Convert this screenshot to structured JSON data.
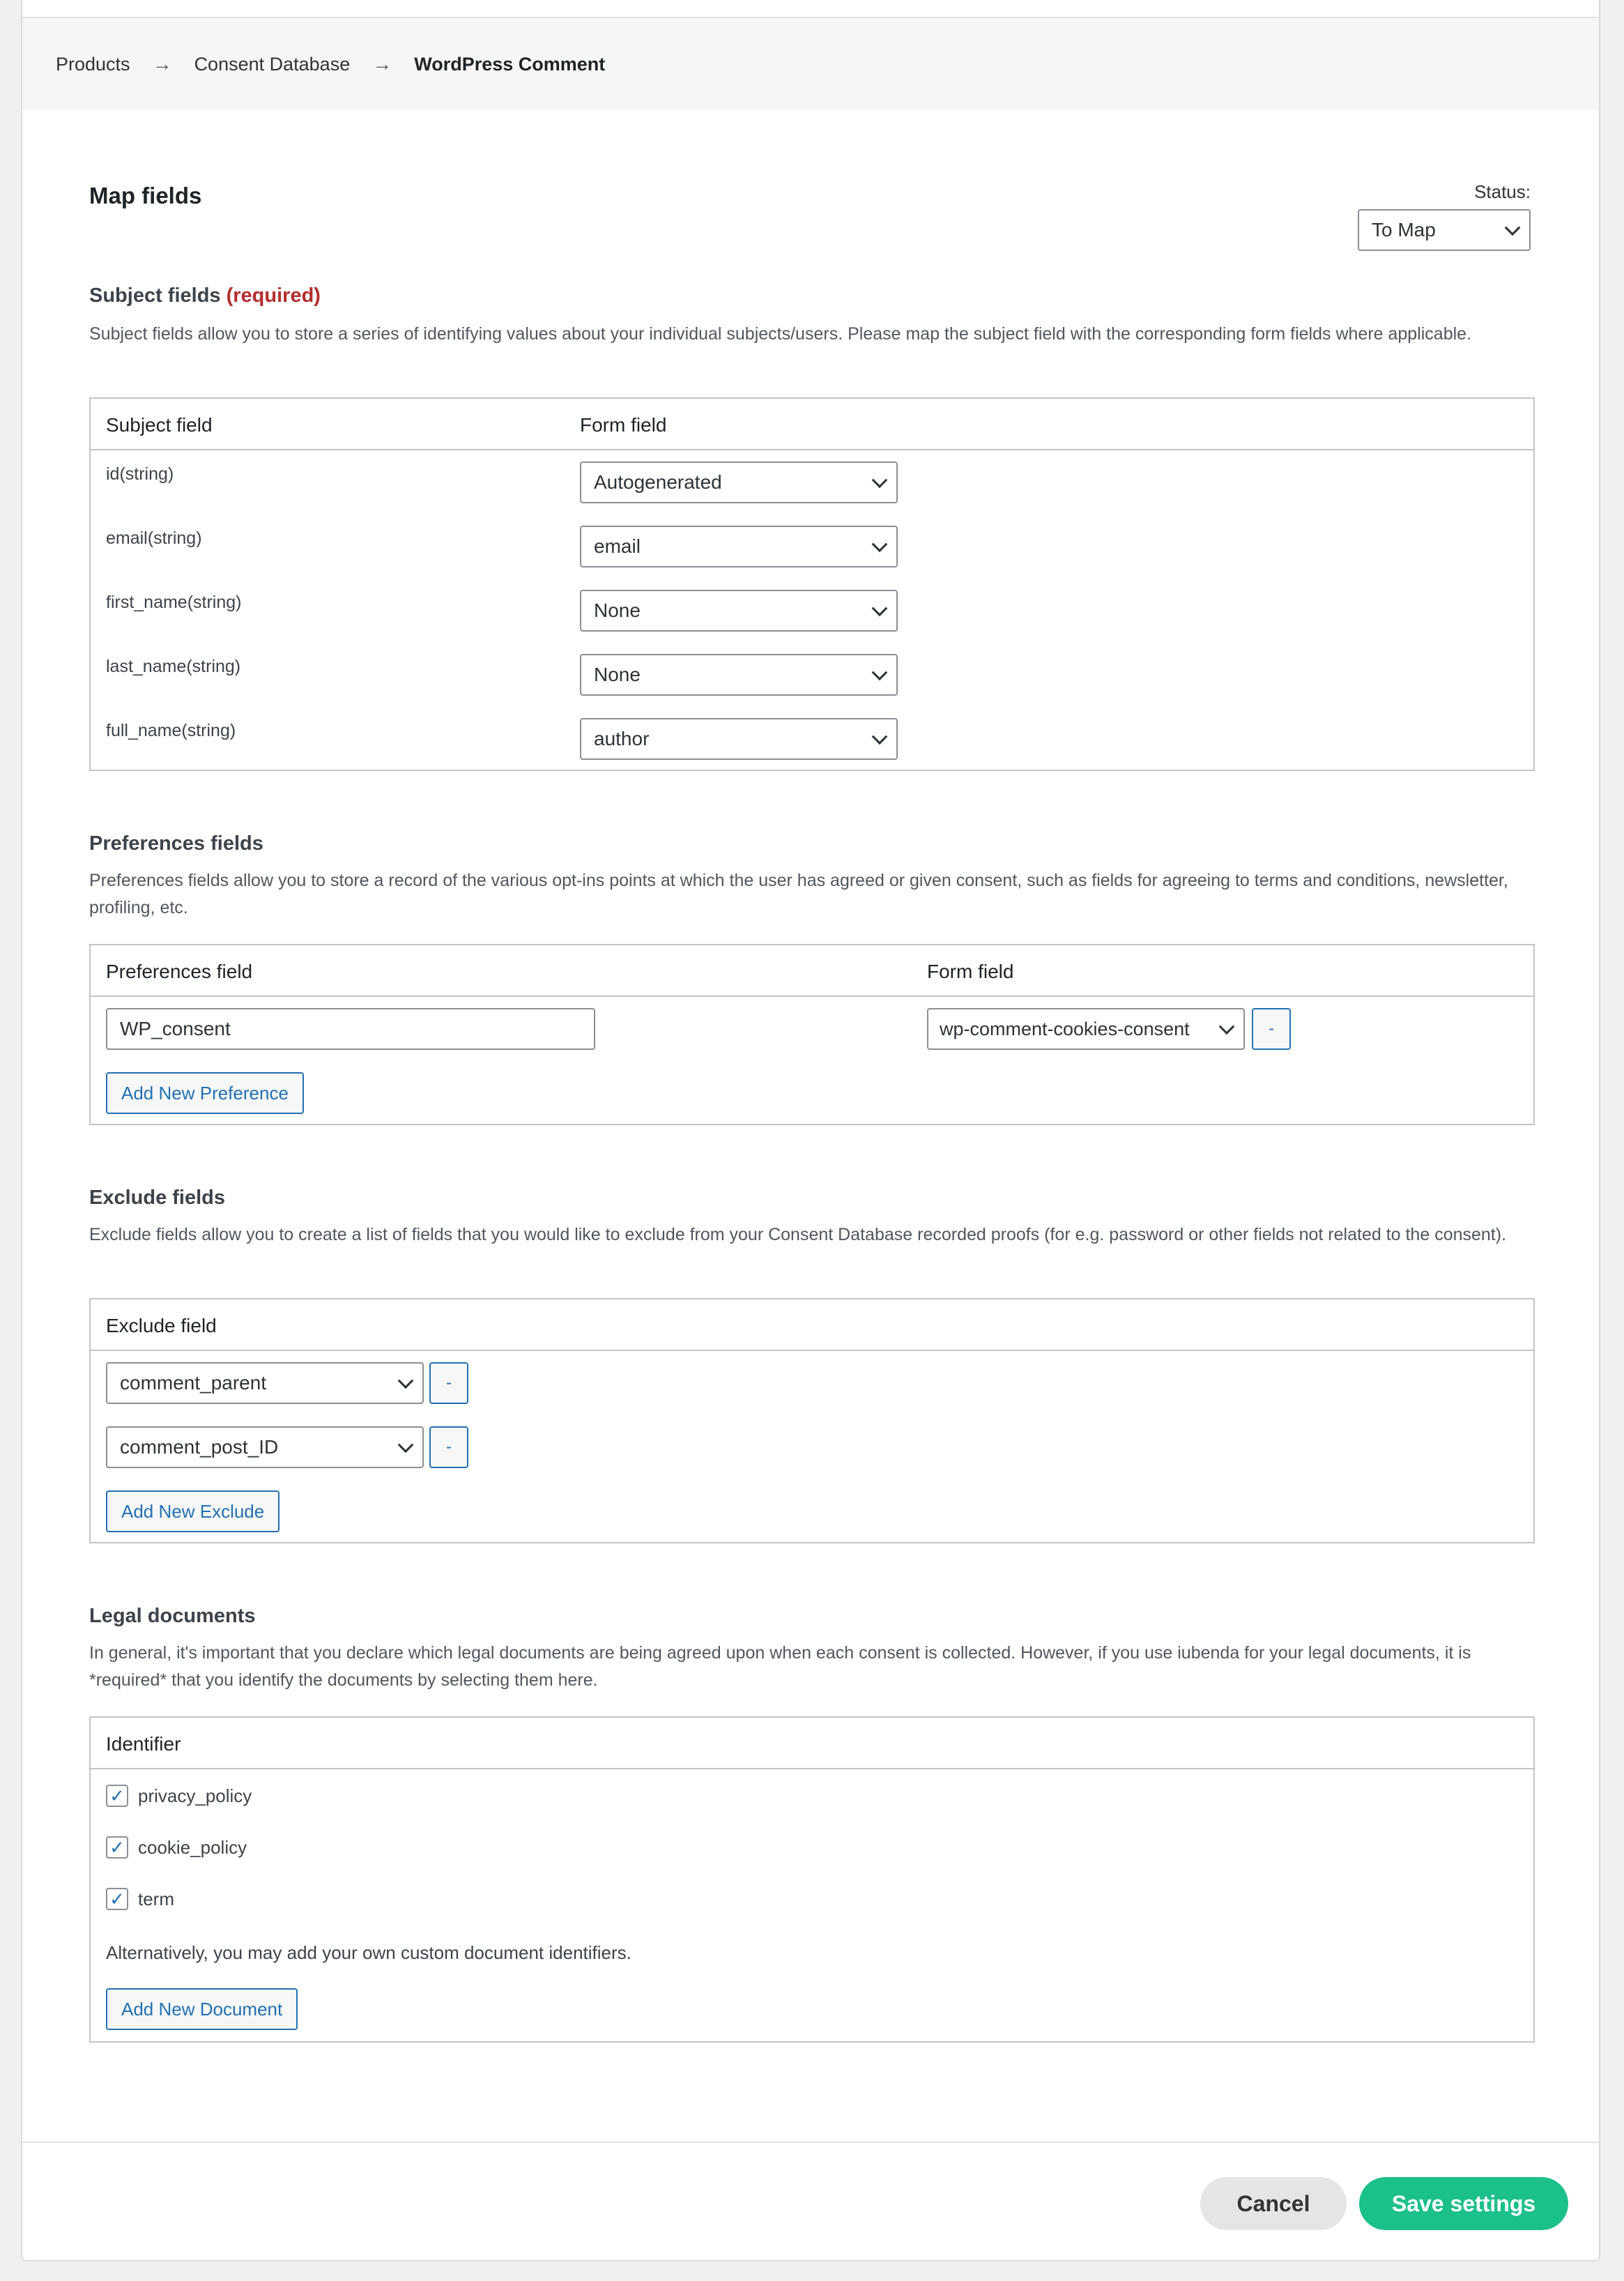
{
  "breadcrumb": {
    "items": [
      "Products",
      "Consent Database",
      "WordPress Comment"
    ],
    "separator": "→"
  },
  "header": {
    "title": "Map fields",
    "status_label": "Status:",
    "status_value": "To Map"
  },
  "subject": {
    "title": "Subject fields",
    "required": "(required)",
    "description": "Subject fields allow you to store a series of identifying values about your individual subjects/users. Please map the subject field with the corresponding form fields where applicable.",
    "col_subject": "Subject field",
    "col_form": "Form field",
    "rows": [
      {
        "label": "id(string)",
        "value": "Autogenerated"
      },
      {
        "label": "email(string)",
        "value": "email"
      },
      {
        "label": "first_name(string)",
        "value": "None"
      },
      {
        "label": "last_name(string)",
        "value": "None"
      },
      {
        "label": "full_name(string)",
        "value": "author"
      }
    ]
  },
  "preferences": {
    "title": "Preferences fields",
    "description": "Preferences fields allow you to store a record of the various opt-ins points at which the user has agreed or given consent, such as fields for agreeing to terms and conditions, newsletter, profiling, etc.",
    "col_pref": "Preferences field",
    "col_form": "Form field",
    "rows": [
      {
        "name": "WP_consent",
        "value": "wp-comment-cookies-consent"
      }
    ],
    "remove_label": "-",
    "add_label": "Add New Preference"
  },
  "exclude": {
    "title": "Exclude fields",
    "description": "Exclude fields allow you to create a list of fields that you would like to exclude from your Consent Database recorded proofs (for e.g. password or other fields not related to the consent).",
    "col_exclude": "Exclude field",
    "rows": [
      {
        "value": "comment_parent"
      },
      {
        "value": "comment_post_ID"
      }
    ],
    "remove_label": "-",
    "add_label": "Add New Exclude"
  },
  "legal": {
    "title": "Legal documents",
    "description": "In general, it's important that you declare which legal documents are being agreed upon when each consent is collected. However, if you use iubenda for your legal documents, it is *required* that you identify the documents by selecting them here.",
    "col_identifier": "Identifier",
    "items": [
      {
        "label": "privacy_policy",
        "checked": true
      },
      {
        "label": "cookie_policy",
        "checked": true
      },
      {
        "label": "term",
        "checked": true
      }
    ],
    "alt_text": "Alternatively, you may add your own custom document identifiers.",
    "add_label": "Add New Document"
  },
  "footer": {
    "cancel_label": "Cancel",
    "save_label": "Save settings"
  },
  "check_glyph": "✓",
  "colors": {
    "accent": "#2271b1",
    "save": "#1cc08a",
    "required": "#b32d2e"
  }
}
